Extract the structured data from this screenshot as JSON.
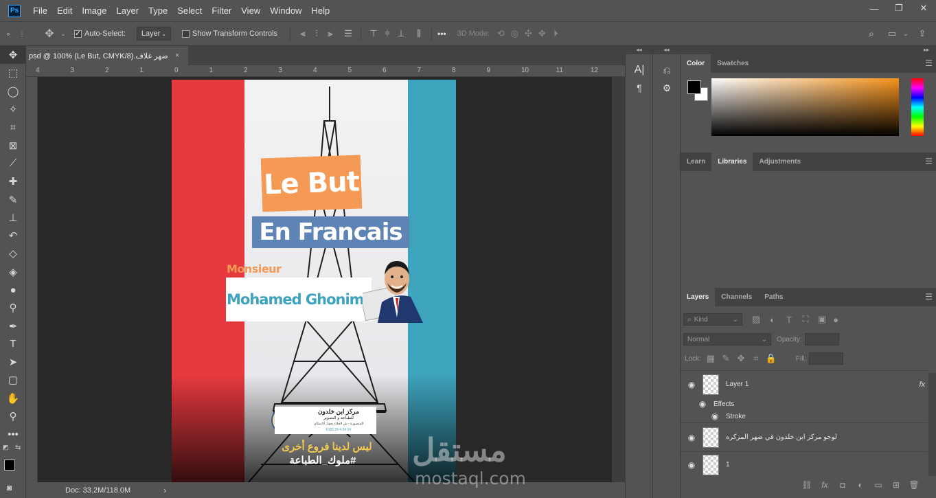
{
  "app": {
    "logo": "Ps",
    "menus": [
      "File",
      "Edit",
      "Image",
      "Layer",
      "Type",
      "Select",
      "Filter",
      "View",
      "Window",
      "Help"
    ],
    "window_controls": {
      "minimize": "—",
      "restore": "❐",
      "close": "✕"
    }
  },
  "options_bar": {
    "auto_select_label": "Auto-Select:",
    "auto_select_checked": true,
    "target_value": "Layer",
    "transform_controls_label": "Show Transform Controls",
    "transform_controls_checked": false,
    "more_label": "•••",
    "mode_3d_label": "3D Mode:"
  },
  "document": {
    "tab_title": "ضهر غلاف.psd @ 100% (Le But, CMYK/8)",
    "tab_close": "×",
    "status": "Doc: 33.2M/118.0M",
    "status_arrow": "›",
    "ruler_ticks": [
      "4",
      "3",
      "2",
      "1",
      "0",
      "1",
      "2",
      "3",
      "4",
      "5",
      "6",
      "7",
      "8",
      "9",
      "10",
      "11",
      "12"
    ]
  },
  "artwork": {
    "title_line1": "Le But",
    "title_line2": "En Francais",
    "monsieur": "Monsieur",
    "name": "Mohamed Ghonim",
    "logo_title": "مركز ابن خلدون",
    "logo_sub": "للطباعة و التصوير",
    "logo_address": "المنصورة - ش الجلاء بجوار الاسكان",
    "logo_phone": "0155 29 4 24 24",
    "tagline_1": "ليس لدينا فروع أخرى",
    "tagline_2": "#ملوك_الطباعة",
    "colors": {
      "red": "#e5393f",
      "blue": "#3ea3bd",
      "orange": "#f49a55",
      "steel": "#5e84b6"
    }
  },
  "watermark": {
    "arabic": "مستقل",
    "latin": "mostaql.com"
  },
  "color_panel": {
    "tabs": [
      "Color",
      "Swatches"
    ],
    "active": "Color",
    "foreground": "#000000",
    "background": "#ffffff"
  },
  "libraries_panel": {
    "tabs": [
      "Learn",
      "Libraries",
      "Adjustments"
    ],
    "active": "Libraries"
  },
  "layers_panel": {
    "tabs": [
      "Layers",
      "Channels",
      "Paths"
    ],
    "active": "Layers",
    "filter_label": "Kind",
    "blend_mode": "Normal",
    "opacity_label": "Opacity:",
    "lock_label": "Lock:",
    "fill_label": "Fill:",
    "layers": [
      {
        "name": "Layer 1",
        "fx": "fx"
      },
      {
        "name": "Effects"
      },
      {
        "name": "Stroke"
      },
      {
        "name": "لوجو مركز ابن خلدون في ضهر المزكره"
      },
      {
        "name": "1"
      }
    ]
  }
}
